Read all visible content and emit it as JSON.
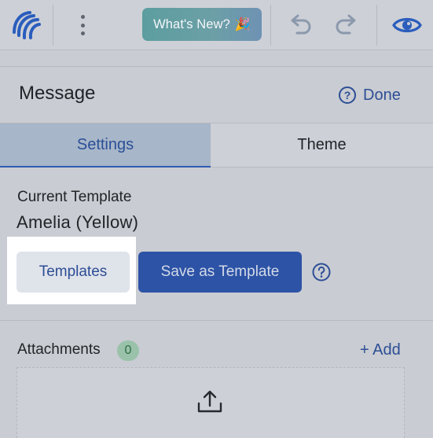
{
  "toolbar": {
    "whats_new_label": "What's New?",
    "whats_new_emoji": "🎉",
    "icons": [
      "logo-icon",
      "kebab-menu-icon",
      "undo-icon",
      "redo-icon",
      "eye-icon"
    ]
  },
  "panel": {
    "title": "Message",
    "help_glyph": "?",
    "done_label": "Done"
  },
  "tabs": [
    {
      "label": "Settings",
      "active": true
    },
    {
      "label": "Theme",
      "active": false
    }
  ],
  "template": {
    "section_label": "Current Template",
    "current_value": "Amelia (Yellow)",
    "templates_button": "Templates",
    "save_button": "Save as Template"
  },
  "attachments": {
    "label": "Attachments",
    "count": "0",
    "add_label": "+ Add"
  },
  "colors": {
    "accent": "#2d53a6",
    "link": "#2d4e95",
    "active_tab_bg": "#a7b6c8",
    "badge_bg": "#9ac2aa"
  }
}
